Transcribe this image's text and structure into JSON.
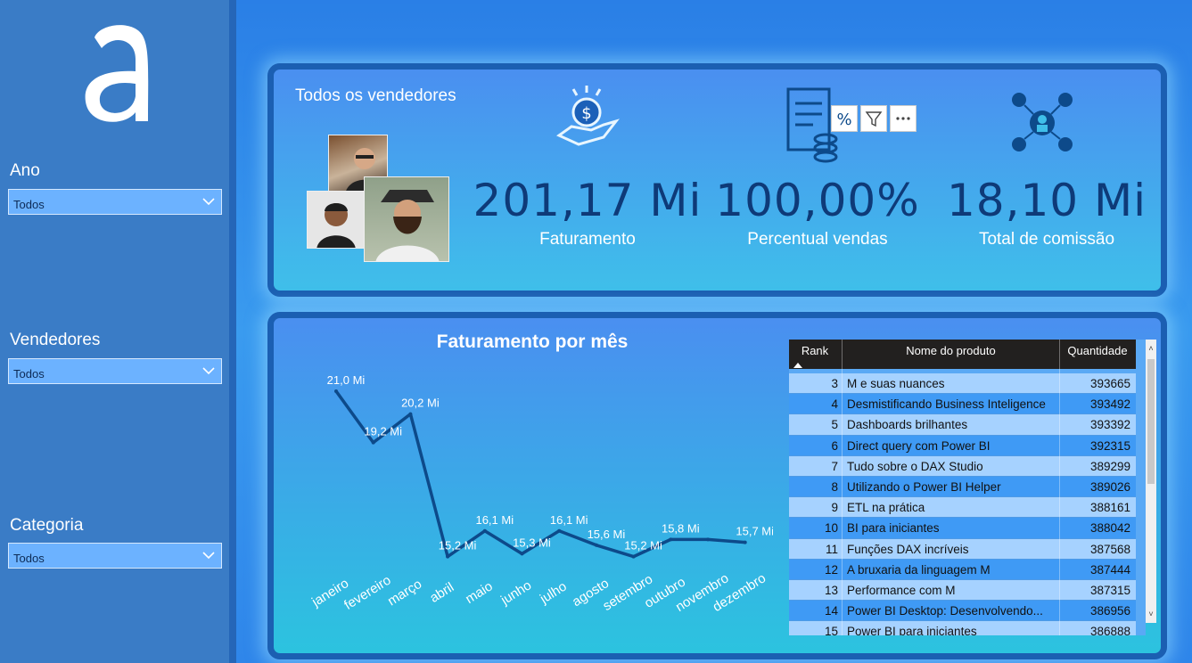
{
  "sidebar": {
    "filters": [
      {
        "label": "Ano",
        "value": "Todos"
      },
      {
        "label": "Vendedores",
        "value": "Todos"
      },
      {
        "label": "Categoria",
        "value": "Todos"
      }
    ]
  },
  "kpi": {
    "title": "Todos os vendedores",
    "cards": [
      {
        "value": "201,17 Mi",
        "label": "Faturamento",
        "icon": "money-hand-icon"
      },
      {
        "value": "100,00%",
        "label": "Percentual vendas",
        "icon": "invoice-percent-icon"
      },
      {
        "value": "18,10 Mi",
        "label": "Total de comissão",
        "icon": "commission-network-icon"
      }
    ]
  },
  "colors": {
    "accent_dark": "#0e3a78",
    "line": "#0d4a8a",
    "table_header": "#22201f"
  },
  "chart_data": {
    "type": "line",
    "title": "Faturamento por mês",
    "categories": [
      "janeiro",
      "fevereiro",
      "março",
      "abril",
      "maio",
      "junho",
      "julho",
      "agosto",
      "setembro",
      "outubro",
      "novembro",
      "dezembro"
    ],
    "values": [
      21.0,
      19.2,
      20.2,
      15.2,
      16.1,
      15.3,
      16.1,
      15.6,
      15.2,
      15.8,
      15.8,
      15.7
    ],
    "data_labels": [
      "21,0 Mi",
      "19,2 Mi",
      "20,2 Mi",
      "15,2 Mi",
      "16,1 Mi",
      "15,3 Mi",
      "16,1 Mi",
      "15,6 Mi",
      "15,2 Mi",
      "15,8 Mi",
      "",
      "15,7 Mi"
    ],
    "ylim": [
      14.5,
      21.5
    ],
    "grid": false
  },
  "table": {
    "headers": [
      "Rank",
      "Nome do produto",
      "Quantidade"
    ],
    "rows": [
      {
        "rank": "3",
        "name": "M e suas nuances",
        "qty": "393665"
      },
      {
        "rank": "4",
        "name": "Desmistificando Business Inteligence",
        "qty": "393492"
      },
      {
        "rank": "5",
        "name": "Dashboards brilhantes",
        "qty": "393392"
      },
      {
        "rank": "6",
        "name": "Direct query com Power BI",
        "qty": "392315"
      },
      {
        "rank": "7",
        "name": "Tudo sobre o DAX Studio",
        "qty": "389299"
      },
      {
        "rank": "8",
        "name": "Utilizando o Power BI Helper",
        "qty": "389026"
      },
      {
        "rank": "9",
        "name": "ETL na prática",
        "qty": "388161"
      },
      {
        "rank": "10",
        "name": "BI para iniciantes",
        "qty": "388042"
      },
      {
        "rank": "11",
        "name": "Funções DAX incríveis",
        "qty": "387568"
      },
      {
        "rank": "12",
        "name": "A bruxaria da linguagem M",
        "qty": "387444"
      },
      {
        "rank": "13",
        "name": "Performance com M",
        "qty": "387315"
      },
      {
        "rank": "14",
        "name": "Power BI Desktop: Desenvolvendo...",
        "qty": "386956"
      },
      {
        "rank": "15",
        "name": "Power BI para iniciantes",
        "qty": "386888"
      }
    ]
  }
}
